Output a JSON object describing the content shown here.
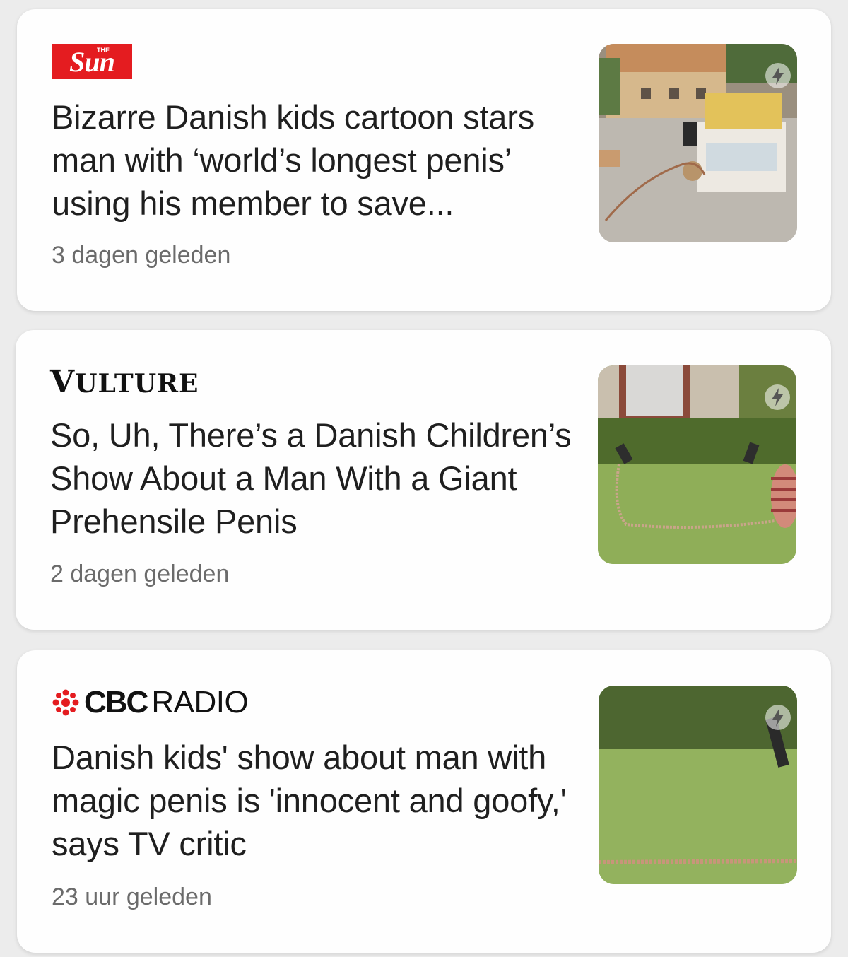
{
  "articles": [
    {
      "source": {
        "name": "The Sun",
        "logo_small": "THE",
        "logo_main": "Sun",
        "logo_color": "#e41c20"
      },
      "headline": "Bizarre Danish kids cartoon stars man with ‘world’s longest penis’ using his member to save...",
      "time": "3 dagen geleden",
      "thumbnail_icon": "amp-lightning-icon"
    },
    {
      "source": {
        "name": "Vulture",
        "logo_first": "V",
        "logo_rest": "ULTURE"
      },
      "headline": "So, Uh, There’s a Danish Children’s Show About a Man With a Giant Prehensile Penis",
      "time": "2 dagen geleden",
      "thumbnail_icon": "amp-lightning-icon"
    },
    {
      "source": {
        "name": "CBC Radio",
        "logo_bold": "CBC",
        "logo_light": "RADIO",
        "logo_color": "#e41c20"
      },
      "headline": "Danish kids' show about man with magic penis is 'innocent and goofy,' says TV critic",
      "time": "23 uur geleden",
      "thumbnail_icon": "amp-lightning-icon"
    }
  ]
}
